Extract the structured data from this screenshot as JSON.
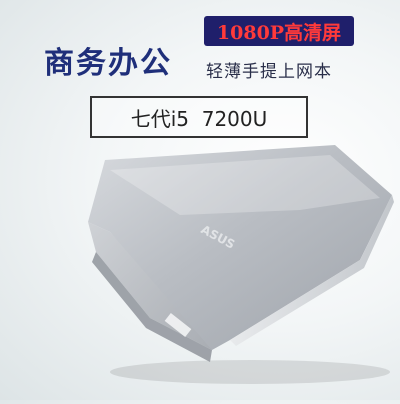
{
  "banner": {
    "headline": "商务办公",
    "badge": "1080P高清屏",
    "subline": "轻薄手提上网本",
    "spec": "七代i5  7200U"
  },
  "product": {
    "logo": "ASUS",
    "colors": {
      "headline": "#1f2f7a",
      "badge_bg": "#1f1f6b",
      "badge_text": "#ff3a3a",
      "lid": "#b8bcc2"
    }
  }
}
